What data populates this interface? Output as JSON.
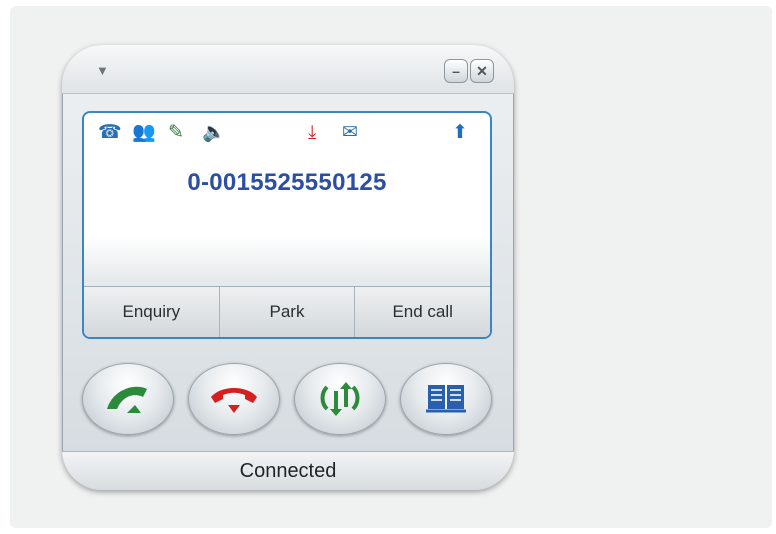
{
  "window": {
    "menu_arrow": "▼",
    "minimize": "–",
    "close": "✕"
  },
  "status_icons": [
    {
      "name": "telephone-icon",
      "glyph": "☎",
      "color": "#2a6fb0"
    },
    {
      "name": "contacts-icon",
      "glyph": "👥",
      "color": "#1f5a92"
    },
    {
      "name": "user-edit-icon",
      "glyph": "✎",
      "color": "#2e7a3a"
    },
    {
      "name": "speaker-icon",
      "glyph": "🔈",
      "color": "#4a5a6a"
    },
    {
      "name": "download-arrow-icon",
      "glyph": "⤓",
      "color": "#d22424"
    },
    {
      "name": "mail-icon",
      "glyph": "✉",
      "color": "#2a6fb0"
    },
    {
      "name": "up-arrow-icon",
      "glyph": "⬆",
      "color": "#1f6fc0"
    }
  ],
  "call": {
    "number": "0-0015525550125"
  },
  "softkeys": [
    {
      "label": "Enquiry"
    },
    {
      "label": "Park"
    },
    {
      "label": "End call"
    }
  ],
  "actions": [
    {
      "name": "answer-call-icon",
      "color": "#2c8a3c"
    },
    {
      "name": "hang-up-icon",
      "color": "#d62020"
    },
    {
      "name": "transfer-icon",
      "color": "#2d8a3a"
    },
    {
      "name": "phonebook-icon",
      "color": "#2a5fb0"
    }
  ],
  "status": {
    "text": "Connected"
  }
}
